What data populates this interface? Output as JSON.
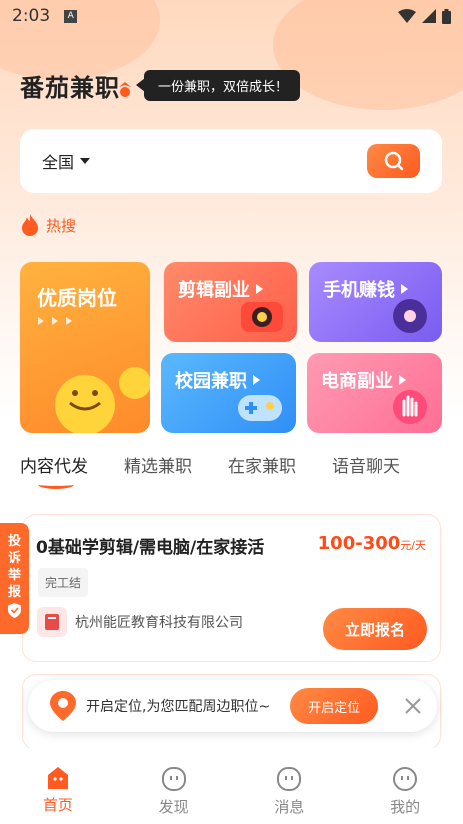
{
  "status_bar": {
    "time": "2:03",
    "notification_icon": "a-icon"
  },
  "brand": {
    "logo": "番茄兼职",
    "slogan": "一份兼职，双倍成长！"
  },
  "search": {
    "region": "全国"
  },
  "hot_search": {
    "label": "热搜"
  },
  "categories": {
    "quality": {
      "label": "优质岗位",
      "color": "#ff9a33"
    },
    "video_edit": {
      "label": "剪辑副业",
      "color": "#ff6b50"
    },
    "phone_earn": {
      "label": "手机赚钱",
      "color": "#8f6cf6"
    },
    "campus": {
      "label": "校园兼职",
      "color": "#3f9cf7"
    },
    "ecommerce": {
      "label": "电商副业",
      "color": "#ff7c9e"
    }
  },
  "tabs": [
    {
      "label": "内容代发",
      "active": true
    },
    {
      "label": "精选兼职",
      "active": false
    },
    {
      "label": "在家兼职",
      "active": false
    },
    {
      "label": "语音聊天",
      "active": false
    }
  ],
  "job": {
    "title": "0基础学剪辑/需电脑/在家接活",
    "salary": "100-300",
    "salary_unit": "元/天",
    "tag": "完工结",
    "company": "杭州能匠教育科技有限公司",
    "apply_label": "立即报名"
  },
  "report": {
    "chars": [
      "投",
      "诉",
      "举",
      "报"
    ]
  },
  "location_banner": {
    "message": "开启定位,为您匹配周边职位~",
    "button": "开启定位"
  },
  "nav": [
    {
      "label": "首页",
      "active": true
    },
    {
      "label": "发现",
      "active": false
    },
    {
      "label": "消息",
      "active": false
    },
    {
      "label": "我的",
      "active": false
    }
  ],
  "colors": {
    "accent": "#ff5a1f"
  }
}
